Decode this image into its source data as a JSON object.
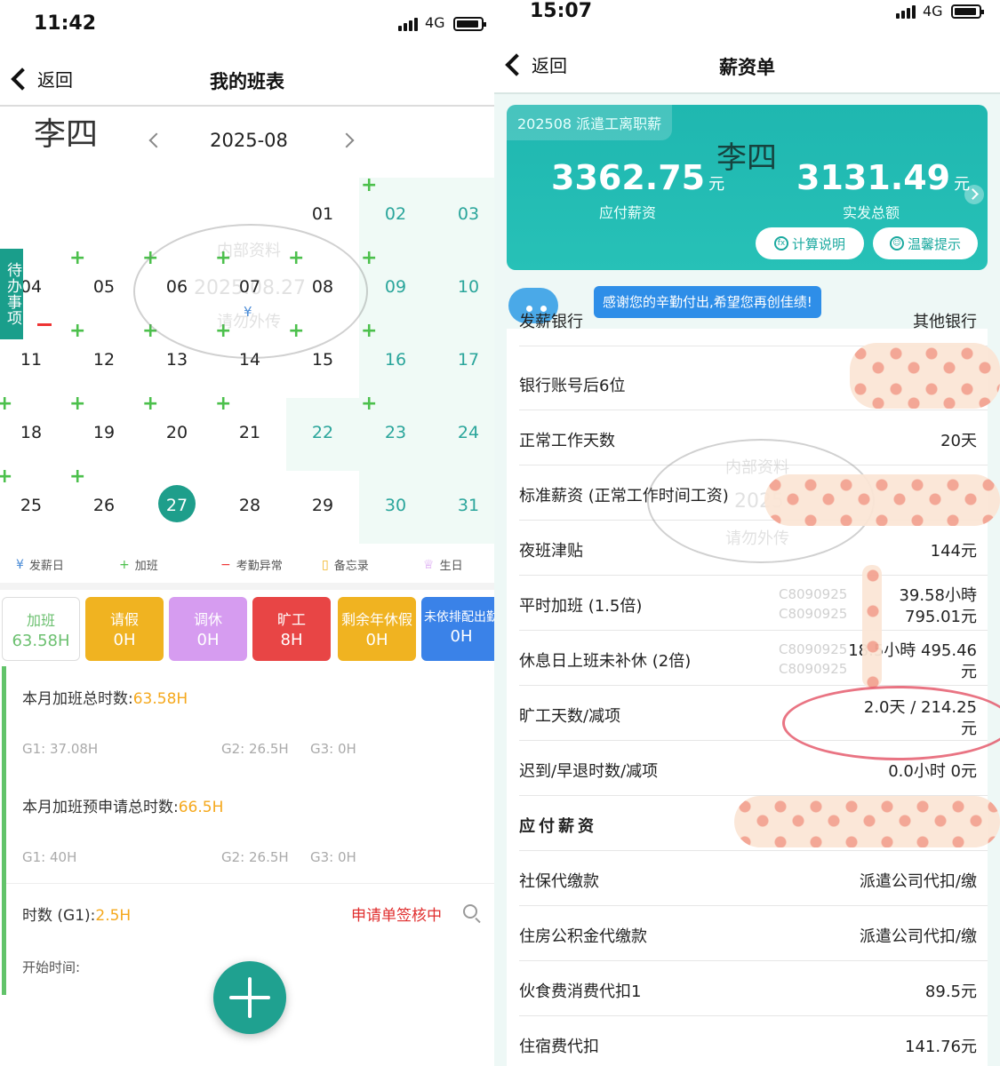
{
  "left": {
    "status": {
      "time": "11:42",
      "network": "4G"
    },
    "nav": {
      "back_label": "返回",
      "title": "我的班表"
    },
    "employee_name": "李四",
    "month": "2025-08",
    "calendar": {
      "days": [
        "01",
        "02",
        "03",
        "04",
        "05",
        "06",
        "07",
        "08",
        "09",
        "10",
        "11",
        "12",
        "13",
        "14",
        "15",
        "16",
        "17",
        "18",
        "19",
        "20",
        "21",
        "22",
        "23",
        "24",
        "25",
        "26",
        "27",
        "28",
        "29",
        "30",
        "31"
      ],
      "pay_marker": "¥"
    },
    "watermark": {
      "line1": "内部资料",
      "line2": "2025.08.27",
      "line3": "请勿外传"
    },
    "todo_tab": "待办事项",
    "legend": {
      "payday": {
        "sym": "¥",
        "label": "发薪日"
      },
      "overtime": {
        "sym": "+",
        "label": "加班"
      },
      "abnormal": {
        "sym": "−",
        "label": "考勤异常"
      },
      "memo": {
        "sym": "▯",
        "label": "备忘录"
      },
      "birthday": {
        "sym": "♕",
        "label": "生日"
      }
    },
    "cards": [
      {
        "label": "加班",
        "value": "63.58H",
        "color": "#ffffff"
      },
      {
        "label": "请假",
        "value": "0H",
        "color": "#f0b321"
      },
      {
        "label": "调休",
        "value": "0H",
        "color": "#d69cf0"
      },
      {
        "label": "旷工",
        "value": "8H",
        "color": "#e84545"
      },
      {
        "label": "剩余年休假",
        "value": "0H",
        "color": "#f0b321"
      },
      {
        "label": "未依排配出勤",
        "value": "0H",
        "color": "#3a82e8"
      }
    ],
    "stats": {
      "total_label": "本月加班总时数:",
      "total_value": "63.58H",
      "g1_total": "G1: 37.08H",
      "g2_total": "G2: 26.5H",
      "g3_total": "G3: 0H",
      "apply_label": "本月加班预申请总时数:",
      "apply_value": "66.5H",
      "g1_apply": "G1: 40H",
      "g2_apply": "G2: 26.5H",
      "g3_apply": "G3: 0H",
      "hours_label": "时数 (G1):",
      "hours_value": "2.5H",
      "status": "申请单签核中",
      "start_label": "开始时间:"
    }
  },
  "right": {
    "status": {
      "time": "15:07",
      "network": "4G"
    },
    "nav": {
      "back_label": "返回",
      "title": "薪资单"
    },
    "hero": {
      "tag": "202508 派遣工离职薪",
      "name": "李四",
      "payable_amount": "3362.75",
      "payable_unit": "元",
      "payable_caption": "应付薪资",
      "net_amount": "3131.49",
      "net_unit": "元",
      "net_caption": "实发总额",
      "calc_button": "计算说明",
      "tips_button": "温馨提示"
    },
    "message": "感谢您的辛勤付出,希望您再创佳绩!",
    "rows": [
      {
        "key": "发薪银行",
        "value": "其他银行"
      },
      {
        "key": "银行账号后6位",
        "value": ""
      },
      {
        "key": "正常工作天数",
        "value": "20天"
      },
      {
        "key": "标准薪资 (正常工作时间工资)",
        "value": ""
      },
      {
        "key": "夜班津贴",
        "value": "144元"
      },
      {
        "key": "平时加班 (1.5倍)",
        "value": "39.58小時",
        "value2": "795.01元"
      },
      {
        "key": "休息日上班未补休 (2倍)",
        "value": "18.5小時 495.46",
        "value2": "元"
      },
      {
        "key": "旷工天数/减项",
        "value": "2.0天  /   214.25",
        "value2": "元"
      },
      {
        "key": "迟到/早退时数/减项",
        "value": "0.0小时    0元"
      },
      {
        "key": "应付薪资",
        "value": ""
      },
      {
        "key": "社保代缴款",
        "value": "派遣公司代扣/缴"
      },
      {
        "key": "住房公积金代缴款",
        "value": "派遣公司代扣/缴"
      },
      {
        "key": "伙食费消费代扣1",
        "value": "89.5元"
      },
      {
        "key": "住宿费代扣",
        "value": "141.76元"
      }
    ],
    "faint_ids": [
      "C8090925",
      "C8090925",
      "C8090925",
      "C8090925"
    ],
    "watermark": {
      "line1": "内部资料",
      "line2": "2025",
      "line3": "请勿外传"
    }
  }
}
